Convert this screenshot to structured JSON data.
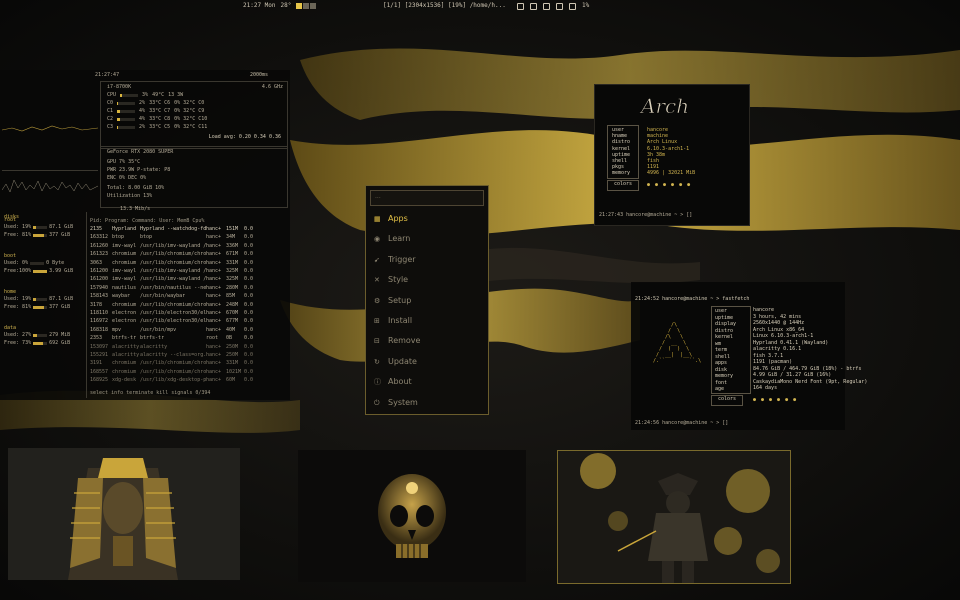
{
  "topbar": {
    "clock": "21:27 Mon",
    "weather": "28°",
    "window": "[1/1] [2304x1536] [19%] /home/h...",
    "battery": "1%"
  },
  "btop": {
    "clock": "21:27:47",
    "cpu_freq": "2000ms",
    "cpu_model": "i7-8700K",
    "ghz": "4.6 GHz",
    "cores": [
      {
        "name": "CPU",
        "pct": "3%",
        "temp": "49°C",
        "extra": "13 3W",
        "fill": 0.03
      },
      {
        "name": "C0",
        "pct": "2%",
        "temp": "33°C C6",
        "extra": "0%  32°C C0",
        "fill": 0.02
      },
      {
        "name": "C1",
        "pct": "4%",
        "temp": "33°C C7",
        "extra": "0%  32°C C9",
        "fill": 0.04
      },
      {
        "name": "C2",
        "pct": "4%",
        "temp": "33°C C8",
        "extra": "0%  32°C C10",
        "fill": 0.04
      },
      {
        "name": "C3",
        "pct": "2%",
        "temp": "33°C C5",
        "extra": "0%  32°C C11",
        "fill": 0.02
      }
    ],
    "loadavg": "Load avg: 0.20 0.34 0.36",
    "gpu": {
      "name": "GeForce RTX 2080 SUPER",
      "gpu_line": "GPU  7%  35°C",
      "pwr_line": "PWR  23.9W  P-state: P8",
      "enc_line": "ENC  0%  DEC  0%",
      "total": "Total:  8.00 GiB  10%",
      "util": "Utilization  13%"
    },
    "speed": "13.3 Mib/s",
    "disks_title": "disks",
    "disks": [
      {
        "label": "root",
        "a": "Used: 19%",
        "b": "87.1 GiB",
        "fill": 0.19
      },
      {
        "label": "IO%",
        "a": "Free: 81%",
        "b": "377 GiB",
        "fill": 0.81
      },
      {
        "label": "boot",
        "a": "Used: 0%",
        "b": "0 Byte",
        "fill": 0.0
      },
      {
        "label": "IO%",
        "a": "Free:100%",
        "b": "3.99 GiB",
        "fill": 1.0
      },
      {
        "label": "home",
        "a": "Used: 19%",
        "b": "87.1 GiB",
        "fill": 0.19
      },
      {
        "label": "IO%",
        "a": "Free: 81%",
        "b": "377 GiB",
        "fill": 0.81
      },
      {
        "label": "data",
        "a": "Used: 27%",
        "b": "279 MiB",
        "fill": 0.27
      },
      {
        "label": "IO%",
        "a": "Free: 73%",
        "b": "692 GiB",
        "fill": 0.73
      }
    ],
    "proc_header": "Pid: Program:    Command:                 User:  MemB   Cpu%",
    "processes": [
      [
        "2135",
        "Hyprland",
        "Hyprland --watchdog-fd",
        "hanc+",
        "151M",
        "0.0"
      ],
      [
        "163312",
        "btop",
        "btop",
        "hanc+",
        "34M",
        "0.0"
      ],
      [
        "161260",
        "imv-wayl",
        "/usr/lib/imv-wayland /h",
        "hanc+",
        "336M",
        "0.0"
      ],
      [
        "161323",
        "chromium",
        "/usr/lib/chromium/chrom",
        "hanc+",
        "671M",
        "0.0"
      ],
      [
        "3063",
        "chromium",
        "/usr/lib/chromium/chrom",
        "hanc+",
        "331M",
        "0.0"
      ],
      [
        "161200",
        "imv-wayl",
        "/usr/lib/imv-wayland /h",
        "hanc+",
        "325M",
        "0.0"
      ],
      [
        "161200",
        "imv-wayl",
        "/usr/lib/imv-wayland /h",
        "hanc+",
        "325M",
        "0.0"
      ],
      [
        "157940",
        "nautilus",
        "/usr/bin/nautilus --new",
        "hanc+",
        "280M",
        "0.0"
      ],
      [
        "158143",
        "waybar",
        "/usr/bin/waybar",
        "hanc+",
        "85M",
        "0.0"
      ],
      [
        "3178",
        "chromium",
        "/usr/lib/chromium/chrom",
        "hanc+",
        "248M",
        "0.0"
      ],
      [
        "118110",
        "electron",
        "/usr/lib/electron30/ele",
        "hanc+",
        "670M",
        "0.0"
      ],
      [
        "116972",
        "electron",
        "/usr/lib/electron30/ele",
        "hanc+",
        "677M",
        "0.0"
      ],
      [
        "168318",
        "mpv",
        "/usr/bin/mpv",
        "hanc+",
        "40M",
        "0.0"
      ],
      [
        "2353",
        "btrfs-tr",
        "btrfs-tr",
        "root",
        "0B",
        "0.0"
      ],
      [
        "153097",
        "alacritty",
        "alacritty",
        "hanc+",
        "250M",
        "0.0"
      ],
      [
        "155291",
        "alacritty",
        "alacritty --class=org.",
        "hanc+",
        "250M",
        "0.0"
      ],
      [
        "3191",
        "chromium",
        "/usr/lib/chromium/chrom",
        "hanc+",
        "331M",
        "0.0"
      ],
      [
        "168557",
        "chromium",
        "/usr/lib/chromium/chrom",
        "hanc+",
        "1021M",
        "0.0"
      ],
      [
        "168925",
        "xdg-desk",
        "/usr/lib/xdg-desktop-po",
        "hanc+",
        "60M",
        "0.0"
      ]
    ],
    "proc_footer": "select  info  terminate  kill  signals  0/394"
  },
  "fastfetch_top": {
    "logo_text": "Arch",
    "rows": [
      {
        "k": "user",
        "v": "hancore"
      },
      {
        "k": "hname",
        "v": "machine"
      },
      {
        "k": "distro",
        "v": "Arch Linux"
      },
      {
        "k": "kernel",
        "v": "6.10.3-arch1-1"
      },
      {
        "k": "uptime",
        "v": "3h 38m"
      },
      {
        "k": "shell",
        "v": "fish"
      },
      {
        "k": "pkgs",
        "v": "1191"
      },
      {
        "k": "memory",
        "v": "4996 | 32021 MiB"
      }
    ],
    "colors": "colors",
    "prompt": "21:27:43  hancore@machine ~ > []"
  },
  "fastfetch_right": {
    "cmd": "21:24:52  hancore@machine ~ > fastfetch",
    "ascii": "      /\\\n     /  \\\n    /\\   \\\n   /  __  \\\n  /  (  )  \\\n /  __|  |__\\\n/.``        ``.\\",
    "labels": [
      "user",
      "uptime",
      "display",
      "distro",
      "kernel",
      "wm",
      "term",
      "shell",
      "apps",
      "disk",
      "memory",
      "font",
      "age"
    ],
    "values": [
      "hancore",
      "3 hours, 42 mins",
      "2560x1440 @ 144Hz",
      "Arch Linux x86_64",
      "Linux 6.10.3-arch1-1",
      "Hyprland 0.41.1 (Wayland)",
      "alacritty 0.16.1",
      "fish 3.7.1",
      "1191 (pacman)",
      "84.76 GiB / 464.79 GiB (18%) - btrfs",
      "4.99 GiB / 31.27 GiB (16%)",
      "CaskaydiaMono Nerd Font (9pt, Regular)",
      "164 days"
    ],
    "colors": "colors",
    "prompt": "21:24:56  hancore@machine ~ > []"
  },
  "menu": {
    "search_placeholder": "...",
    "items": [
      {
        "label": "Apps",
        "icon": "apps-icon",
        "glyph": "▦"
      },
      {
        "label": "Learn",
        "icon": "learn-icon",
        "glyph": "◉"
      },
      {
        "label": "Trigger",
        "icon": "trigger-icon",
        "glyph": "➹"
      },
      {
        "label": "Style",
        "icon": "style-icon",
        "glyph": "✕"
      },
      {
        "label": "Setup",
        "icon": "setup-icon",
        "glyph": "⚙"
      },
      {
        "label": "Install",
        "icon": "install-icon",
        "glyph": "⊞"
      },
      {
        "label": "Remove",
        "icon": "remove-icon",
        "glyph": "⊟"
      },
      {
        "label": "Update",
        "icon": "update-icon",
        "glyph": "↻"
      },
      {
        "label": "About",
        "icon": "about-icon",
        "glyph": "ⓘ"
      },
      {
        "label": "System",
        "icon": "power-icon",
        "glyph": "⏻"
      }
    ]
  },
  "colors": {
    "accent": "#e4c247",
    "panel": "#080807",
    "border": "#6b5d2c"
  }
}
